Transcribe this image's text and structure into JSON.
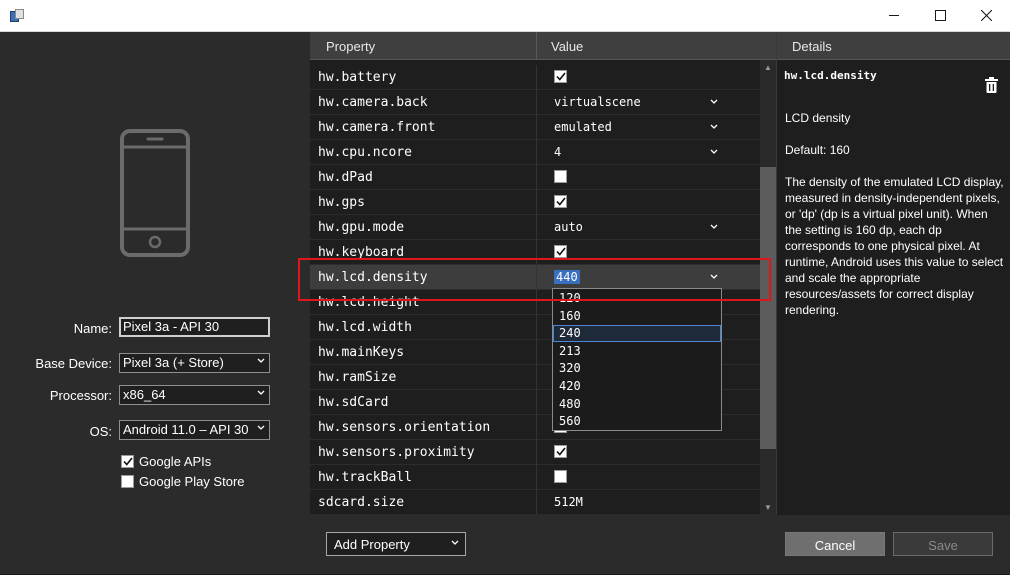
{
  "titlebar": {
    "title": ""
  },
  "left_panel": {
    "name_label": "Name:",
    "name_value": "Pixel 3a - API 30",
    "base_device_label": "Base Device:",
    "base_device_value": "Pixel 3a (+ Store)",
    "processor_label": "Processor:",
    "processor_value": "x86_64",
    "os_label": "OS:",
    "os_value": "Android 11.0 – API 30",
    "google_apis_label": "Google APIs",
    "google_apis_checked": true,
    "google_play_label": "Google Play Store",
    "google_play_checked": false
  },
  "grid": {
    "header_property": "Property",
    "header_value": "Value",
    "rows": [
      {
        "property": "hw.battery",
        "type": "check",
        "checked": true
      },
      {
        "property": "hw.camera.back",
        "type": "select",
        "value": "virtualscene"
      },
      {
        "property": "hw.camera.front",
        "type": "select",
        "value": "emulated"
      },
      {
        "property": "hw.cpu.ncore",
        "type": "select",
        "value": "4"
      },
      {
        "property": "hw.dPad",
        "type": "check",
        "checked": false
      },
      {
        "property": "hw.gps",
        "type": "check",
        "checked": true
      },
      {
        "property": "hw.gpu.mode",
        "type": "select",
        "value": "auto"
      },
      {
        "property": "hw.keyboard",
        "type": "check",
        "checked": true
      },
      {
        "property": "hw.lcd.density",
        "type": "select",
        "value": "440",
        "selected": true
      },
      {
        "property": "hw.lcd.height",
        "type": "text",
        "value": ""
      },
      {
        "property": "hw.lcd.width",
        "type": "text",
        "value": ""
      },
      {
        "property": "hw.mainKeys",
        "type": "text",
        "value": ""
      },
      {
        "property": "hw.ramSize",
        "type": "text",
        "value": ""
      },
      {
        "property": "hw.sdCard",
        "type": "text",
        "value": ""
      },
      {
        "property": "hw.sensors.orientation",
        "type": "check",
        "checked": true
      },
      {
        "property": "hw.sensors.proximity",
        "type": "check",
        "checked": true
      },
      {
        "property": "hw.trackBall",
        "type": "check",
        "checked": false
      },
      {
        "property": "sdcard.size",
        "type": "text",
        "value": "512M"
      }
    ]
  },
  "dropdown": {
    "options": [
      "120",
      "160",
      "240",
      "213",
      "320",
      "420",
      "480",
      "560"
    ],
    "hovered": "240"
  },
  "details": {
    "header": "Details",
    "title": "hw.lcd.density",
    "summary": "LCD density",
    "default": "Default: 160",
    "description": "The density of the emulated LCD display, measured in density-independent pixels, or 'dp' (dp is a virtual pixel unit). When the setting is 160 dp, each dp corresponds to one physical pixel. At runtime, Android uses this value to select and scale the appropriate resources/assets for correct display rendering."
  },
  "footer": {
    "add_property_label": "Add Property",
    "cancel_label": "Cancel",
    "save_label": "Save"
  },
  "colors": {
    "background": "#2b2b2b",
    "grid_background": "#1e1e1e",
    "header_background": "#3f3f3f",
    "highlight_frame": "#e0161c",
    "selection": "#3a6fbf"
  }
}
